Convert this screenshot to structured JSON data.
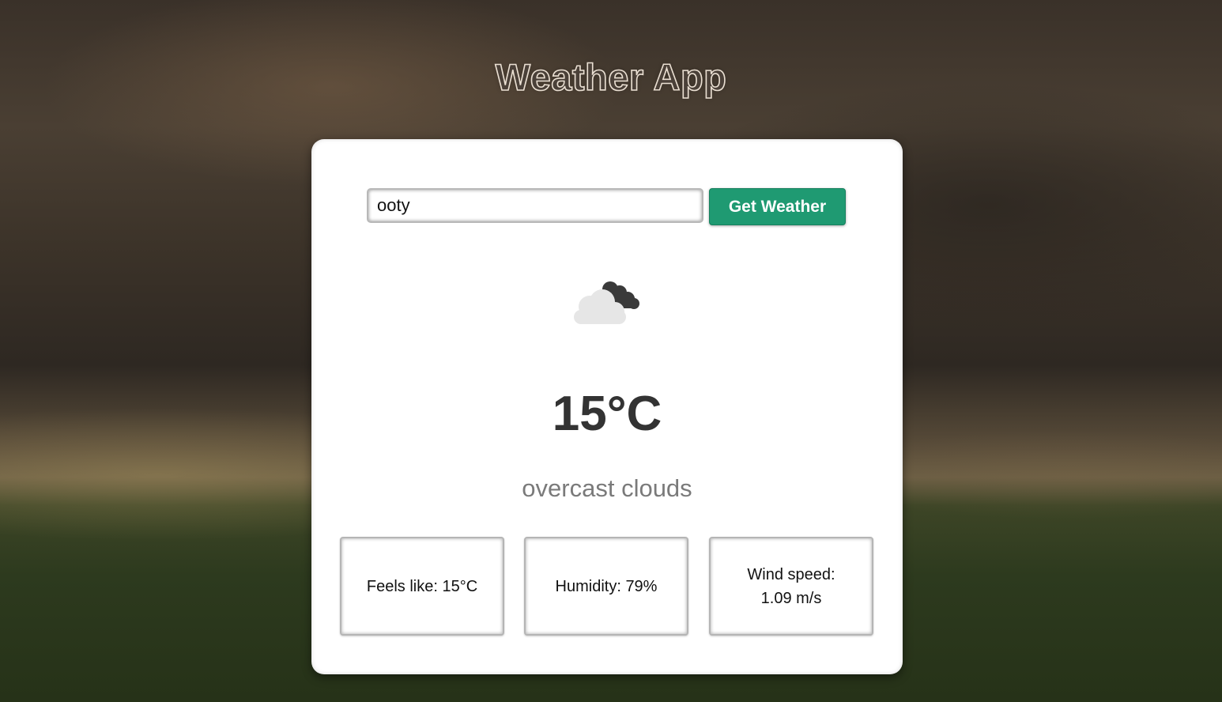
{
  "app": {
    "title": "Weather App"
  },
  "search": {
    "value": "ooty",
    "button_label": "Get Weather"
  },
  "weather": {
    "icon": "overcast-clouds-icon",
    "temperature": "15°C",
    "description": "overcast clouds"
  },
  "details": {
    "feels_like": "Feels like: 15°C",
    "humidity": "Humidity: 79%",
    "wind_line1": "Wind speed:",
    "wind_line2": "1.09 m/s"
  },
  "colors": {
    "button": "#1f9a72",
    "temperature_text": "#333333",
    "description_text": "#7a7a7a"
  }
}
